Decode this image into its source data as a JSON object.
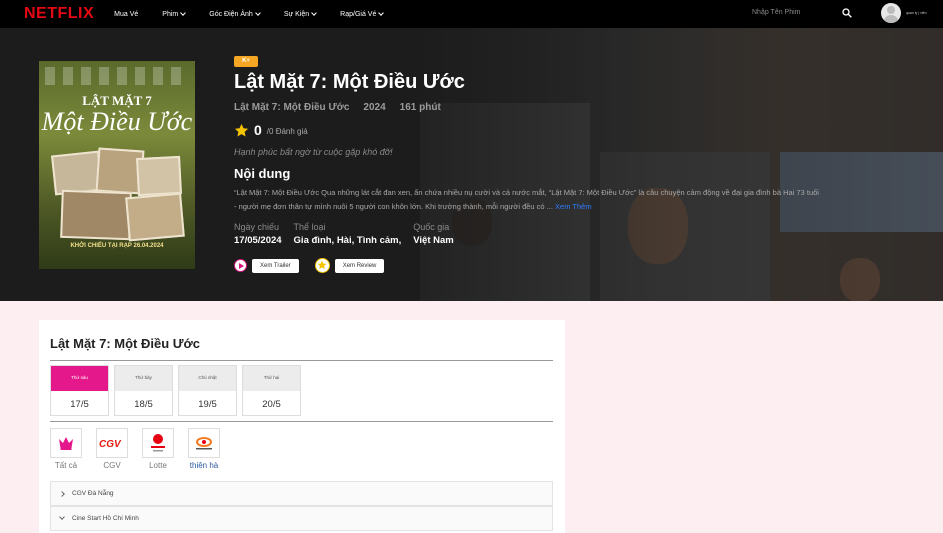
{
  "nav": {
    "logo": "NETFLIX",
    "items": [
      {
        "label": "Mua Vé",
        "has_caret": false
      },
      {
        "label": "Phim",
        "has_caret": true
      },
      {
        "label": "Góc Điện Ảnh",
        "has_caret": true
      },
      {
        "label": "Sự Kiện",
        "has_caret": true
      },
      {
        "label": "Rạp/Giá Vé",
        "has_caret": true
      }
    ],
    "search_placeholder": "Nhập Tên Phim",
    "user_name": "quan ly | viên"
  },
  "movie": {
    "poster_title_line1": "LẬT MẶT 7",
    "poster_title_line2": "Một Điều Ước",
    "poster_date": "KHỞI CHIẾU TẠI RẠP 26.04.2024",
    "age_rating": "K+",
    "title": "Lật Mặt 7: Một Điều Ước",
    "subtitle": "Lật Mặt 7: Một Điều Ước",
    "year": "2024",
    "duration": "161 phút",
    "score": "0",
    "score_caption": "/0 Đánh giá",
    "tagline": "Hạnh phúc bất ngờ từ cuộc gặp khó đỡ!",
    "content_heading": "Nội dung",
    "description": "“Lật Mặt 7: Một Điều Ước  Qua những lát cắt đan xen, ẩn chứa nhiều nụ cười và cả nước mắt, “Lật Mặt 7: Một Điều Ước” là câu chuyện cảm động về đại gia đình bà Hai 73 tuổi - người mẹ đơn thân tự mình nuôi 5 người con khôn lớn. Khi trưởng thành, mỗi người đều có ...",
    "see_more": "Xem Thêm",
    "release_label": "Ngày chiếu",
    "release_value": "17/05/2024",
    "genre_label": "Thể loại",
    "genre_value": "Gia đình, Hài, Tình cảm,",
    "country_label": "Quốc gia",
    "country_value": "Việt Nam",
    "trailer_label": "Xem Trailer",
    "review_label": "Xem Review"
  },
  "schedule": {
    "title": "Lật Mặt 7: Một Điều Ước",
    "dates": [
      {
        "day": "Thứ sáu",
        "date": "17/5",
        "active": true
      },
      {
        "day": "Thứ bảy",
        "date": "18/5",
        "active": false
      },
      {
        "day": "Chủ nhật",
        "date": "19/5",
        "active": false
      },
      {
        "day": "Thứ hai",
        "date": "20/5",
        "active": false
      }
    ],
    "cinemas": [
      {
        "label": "Tất cả",
        "icon": "crown-icon",
        "color": "#e5188b"
      },
      {
        "label": "CGV",
        "icon": "cgv-logo",
        "color": "#e71a0f"
      },
      {
        "label": "Lotte",
        "icon": "lotte-logo",
        "color": "#e60012"
      },
      {
        "label": "thiên hà",
        "icon": "galaxy-logo",
        "color": "#f47a20"
      }
    ],
    "accordions": [
      {
        "label": "CGV Đà Nẵng"
      },
      {
        "label": "Cine Start Hồ Chí Minh"
      }
    ]
  },
  "colors": {
    "brand_red": "#e50914",
    "accent_pink": "#e5188b",
    "star_yellow": "#f5c400",
    "link_blue": "#2f7bff"
  }
}
